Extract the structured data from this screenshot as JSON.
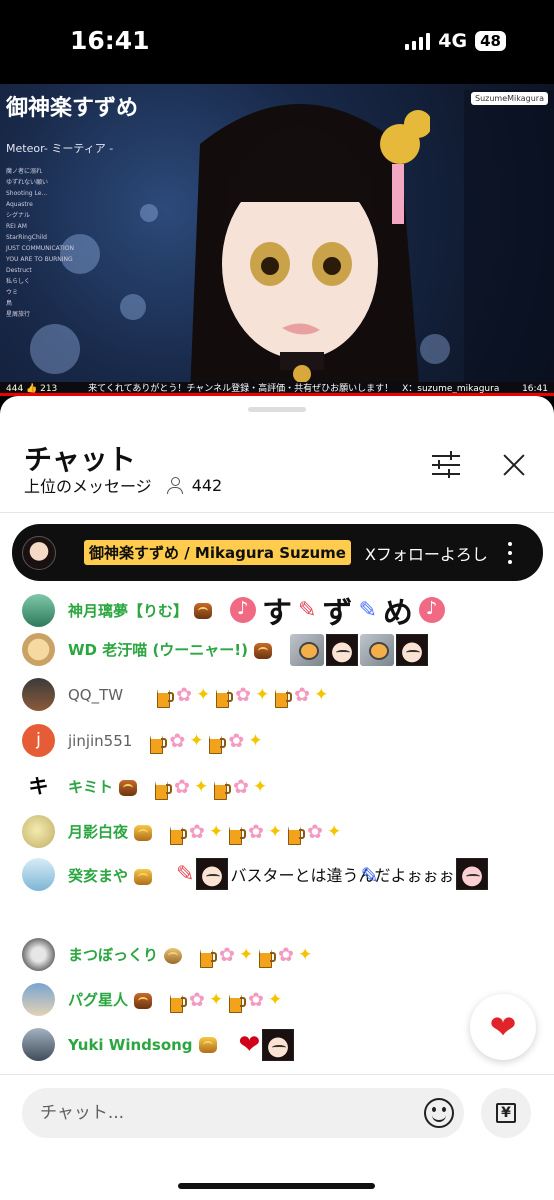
{
  "status_bar": {
    "time": "16:41",
    "network": "4G",
    "battery": "48"
  },
  "video": {
    "logo": "御神楽すずめ",
    "song": "Meteor- ミーティア -",
    "setlist": [
      "魔ノ者に溺れ",
      "ゆずれない願い",
      "Shooting Le...",
      "Aquastre",
      "シグナル",
      "REI AM",
      "StarRingChild",
      "JUST COMMUNICATION",
      "YOU ARE TO BURNING",
      "Destruct",
      "私らしく",
      "ウミ",
      "鳥",
      "星屑旅行"
    ],
    "channel_tag": "SuzumeMikagura",
    "ticker_stats": "444 👍 213",
    "ticker": "来てくれてありがとう！チャンネル登録・高評価・共有ぜひお願いします！　X：suzume_mikagura",
    "ticker_time": "16:41"
  },
  "chat": {
    "title": "チャット",
    "mode": "上位のメッセージ",
    "viewers": "442",
    "input_placeholder": "チャット...",
    "superchat_label": "¥"
  },
  "pinned": {
    "author": "御神楽すずめ / Mikagura Suzume",
    "message": "Xフォローよろしくお願いします"
  },
  "messages": [
    {
      "author": "神月璃夢【りむ】",
      "text_chars": [
        "す",
        "ず",
        "め"
      ]
    },
    {
      "author": "WD 老汙喵 (ウーニャー!)"
    },
    {
      "author": "QQ_TW"
    },
    {
      "author": "jinjin551",
      "avatar_letter": "j"
    },
    {
      "author": "キミト",
      "avatar_letter": "キミ"
    },
    {
      "author": "月影白夜"
    },
    {
      "author": "癸亥まや",
      "text": "バスターとは違うんだよぉぉぉ"
    },
    {
      "author": "まつぼっくり"
    },
    {
      "author": "パグ星人"
    },
    {
      "author": "Yuki Windsong"
    }
  ],
  "colors": {
    "member_name": "#2ba640",
    "owner_badge": "#ffcc4d",
    "heart": "#e0242a"
  }
}
